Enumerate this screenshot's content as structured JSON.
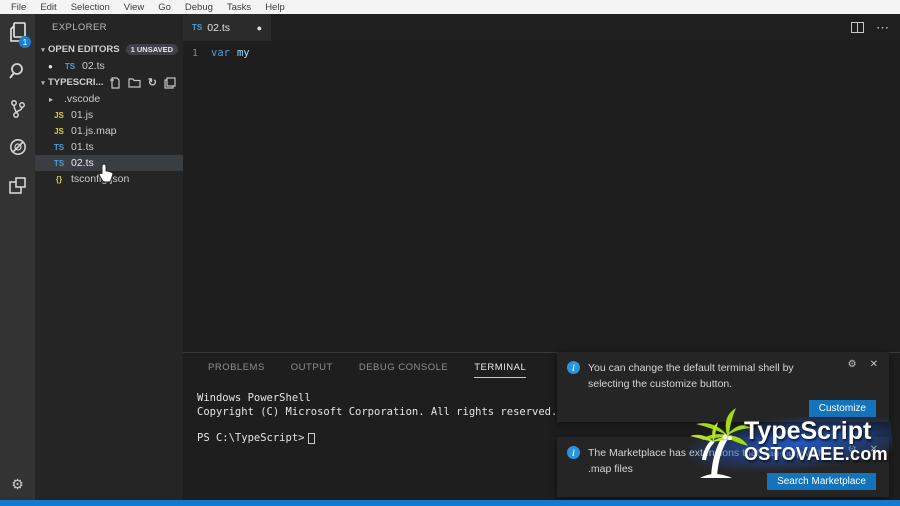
{
  "menu": {
    "items": [
      "File",
      "Edit",
      "Selection",
      "View",
      "Go",
      "Debug",
      "Tasks",
      "Help"
    ]
  },
  "activity_bar": {
    "explorer_badge": "1"
  },
  "sidebar": {
    "title": "EXPLORER",
    "open_editors": {
      "label": "OPEN EDITORS",
      "badge": "1 UNSAVED",
      "file": "02.ts"
    },
    "folder_label": "TYPESCRI...",
    "files": [
      ".vscode",
      "01.js",
      "01.js.map",
      "01.ts",
      "02.ts",
      "tsconfig.json"
    ]
  },
  "editor": {
    "tab_label": "02.ts",
    "line_number": "1",
    "code_keyword": "var",
    "code_identifier": "my"
  },
  "panel": {
    "tabs": [
      "PROBLEMS",
      "OUTPUT",
      "DEBUG CONSOLE",
      "TERMINAL"
    ],
    "active_tab": "TERMINAL",
    "terminal_lines": [
      "Windows PowerShell",
      "Copyright (C) Microsoft Corporation. All rights reserved."
    ],
    "prompt": "PS C:\\TypeScript>"
  },
  "notifications": [
    {
      "message": "You can change the default terminal shell by selecting the customize button.",
      "button": "Customize"
    },
    {
      "message": "The Marketplace has extensions that can help with .map files",
      "button": "Search Marketplace"
    }
  ],
  "watermark": {
    "title": "TypeScript",
    "site": "OSTOVAEE.com"
  },
  "icons": {
    "ts": "TS",
    "js": "JS",
    "json_braces": "{}",
    "gear": "⚙",
    "close": "✕",
    "refresh": "↻",
    "ellipsis": "⋯",
    "dot": "●",
    "chevron_right": "▸",
    "arrow_down": "▾",
    "info": "i"
  },
  "colors": {
    "accent": "#127ace",
    "button": "#1374bb",
    "ts_icon": "#4d9fd6",
    "js_icon": "#dbc94a"
  }
}
